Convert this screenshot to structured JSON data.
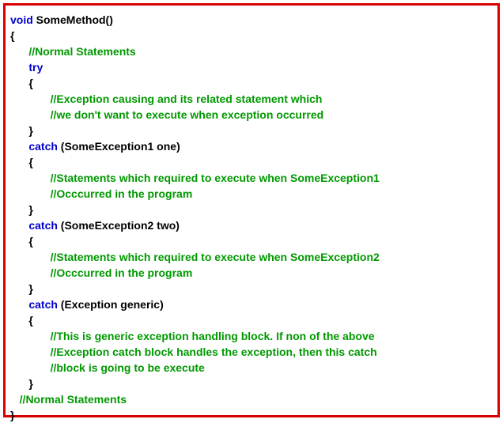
{
  "code": {
    "kw_void": "void",
    "method_name": " SomeMethod()",
    "brace_open": "{",
    "brace_close": "}",
    "cm_normal": "//Normal Statements",
    "kw_try": "try",
    "cm_try1": "//Exception causing and its related statement which",
    "cm_try2": "//we don't want to execute when exception occurred",
    "kw_catch": "catch",
    "catch1_sig": " (SomeException1 one)",
    "cm_c1a": "//Statements which required to execute when SomeException1",
    "cm_c1b": "//Occcurred in the program",
    "catch2_sig": " (SomeException2 two)",
    "cm_c2a": "//Statements which required to execute when SomeException2",
    "cm_c2b": "//Occcurred in the program",
    "catch3_sig": " (Exception generic)",
    "cm_c3a": "//This is generic exception handling block. If non of the above",
    "cm_c3b": "//Exception catch block handles the exception, then this catch",
    "cm_c3c": "//block is going to be execute",
    "cm_normal_end": "//Normal Statements"
  }
}
